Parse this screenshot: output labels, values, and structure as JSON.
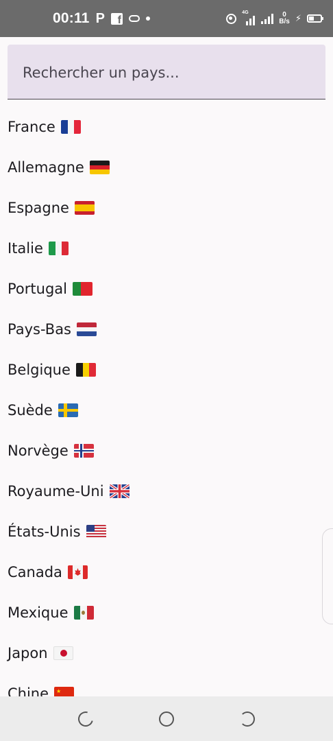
{
  "status_bar": {
    "time": "00:11",
    "parking_glyph": "P",
    "network_type": "4G",
    "net_speed_value": "0",
    "net_speed_unit": "B/s",
    "icons": [
      "facebook-icon",
      "game-controller-icon",
      "dot-icon",
      "hotspot-icon",
      "signal-icon",
      "signal-icon",
      "bolt-icon",
      "battery-icon"
    ]
  },
  "search": {
    "placeholder": "Rechercher un pays...",
    "value": ""
  },
  "countries": [
    {
      "name": "France",
      "flag": "france-flag-icon"
    },
    {
      "name": "Allemagne",
      "flag": "germany-flag-icon"
    },
    {
      "name": "Espagne",
      "flag": "spain-flag-icon"
    },
    {
      "name": "Italie",
      "flag": "italy-flag-icon"
    },
    {
      "name": "Portugal",
      "flag": "portugal-flag-icon"
    },
    {
      "name": "Pays-Bas",
      "flag": "netherlands-flag-icon"
    },
    {
      "name": "Belgique",
      "flag": "belgium-flag-icon"
    },
    {
      "name": "Suède",
      "flag": "sweden-flag-icon"
    },
    {
      "name": "Norvège",
      "flag": "norway-flag-icon"
    },
    {
      "name": "Royaume-Uni",
      "flag": "uk-flag-icon"
    },
    {
      "name": "États-Unis",
      "flag": "usa-flag-icon"
    },
    {
      "name": "Canada",
      "flag": "canada-flag-icon"
    },
    {
      "name": "Mexique",
      "flag": "mexico-flag-icon"
    },
    {
      "name": "Japon",
      "flag": "japan-flag-icon"
    },
    {
      "name": "Chine",
      "flag": "china-flag-icon"
    }
  ],
  "nav_bar": {
    "buttons": [
      "recent-apps-icon",
      "home-icon",
      "back-icon"
    ]
  }
}
